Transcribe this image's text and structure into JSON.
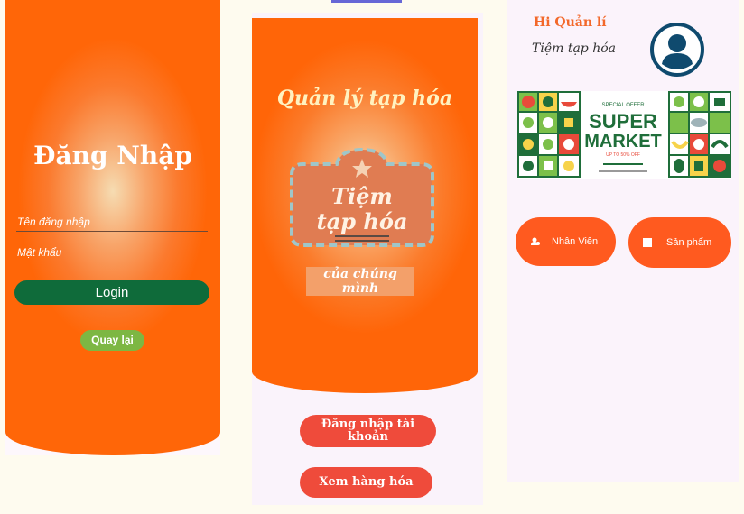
{
  "login": {
    "title": "Đăng Nhập",
    "username_placeholder": "Tên đăng nhập",
    "password_placeholder": "Mật khẩu",
    "login_label": "Login",
    "back_label": "Quay lại"
  },
  "splash": {
    "title": "Quản lý tạp hóa",
    "logo_line1": "Tiệm",
    "logo_line2": "tạp hóa",
    "logo_sub": "của chúng mình",
    "login_account_label": "Đăng nhập tài khoản",
    "view_goods_label": "Xem hàng hóa"
  },
  "home": {
    "greeting": "Hi Quản lí",
    "shop_name": "Tiệm tạp hóa",
    "banner": {
      "offer": "SPECIAL OFFER",
      "line1": "SUPER",
      "line2": "MARKET",
      "discount": "UP TO 50% OFF"
    },
    "staff_label": "Nhân Viên",
    "products_label": "Sản phẩm"
  },
  "colors": {
    "orange": "#ff6608",
    "green": "#0f6b3a",
    "red_button": "#ef4b3b",
    "pill": "#ff5a1f",
    "avatar": "#0f4a6e"
  }
}
